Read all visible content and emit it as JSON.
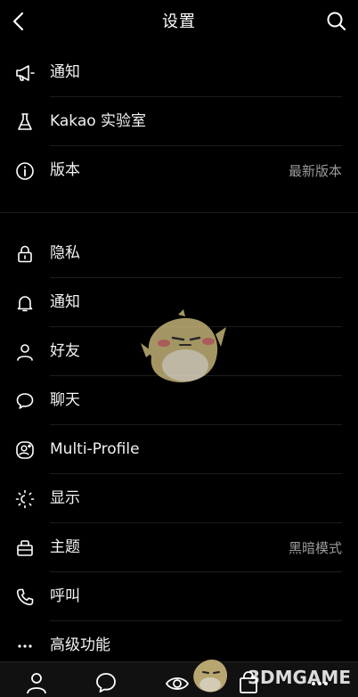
{
  "header": {
    "title": "设置"
  },
  "section1": [
    {
      "label": "通知",
      "icon": "megaphone-icon"
    },
    {
      "label": "Kakao 实验室",
      "icon": "flask-icon"
    },
    {
      "label": "版本",
      "icon": "info-icon",
      "value": "最新版本"
    }
  ],
  "section2": [
    {
      "label": "隐私",
      "icon": "lock-icon"
    },
    {
      "label": "通知",
      "icon": "bell-icon"
    },
    {
      "label": "好友",
      "icon": "person-icon"
    },
    {
      "label": "聊天",
      "icon": "chat-bubble-icon"
    },
    {
      "label": "Multi-Profile",
      "icon": "multi-profile-icon"
    },
    {
      "label": "显示",
      "icon": "sun-icon"
    },
    {
      "label": "主题",
      "icon": "theme-icon",
      "value": "黑暗模式"
    },
    {
      "label": "呼叫",
      "icon": "phone-icon"
    },
    {
      "label": "高级功能",
      "icon": "more-icon"
    }
  ],
  "tabbar": {
    "tabs": [
      "friends-tab",
      "chats-tab",
      "view-tab",
      "shopping-tab",
      "more-tab"
    ]
  },
  "watermark": {
    "text": "3DMGAME"
  },
  "colors": {
    "background": "#000000",
    "text": "#f2f2f2",
    "secondary_text": "#9a9a9a",
    "divider": "#1d1d1d",
    "mascot_yellow": "#c9b77a"
  }
}
